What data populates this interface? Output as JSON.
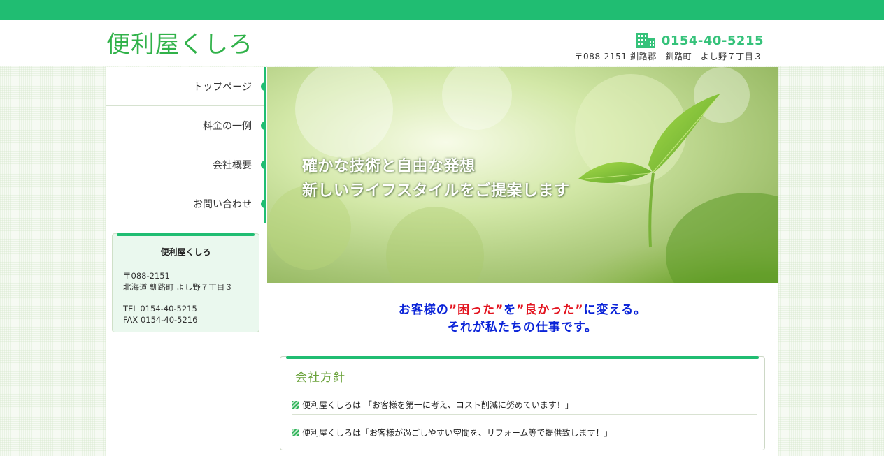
{
  "header": {
    "site_title": "便利屋くしろ",
    "phone": "0154-40-5215",
    "address": "〒088-2151 釧路郡　釧路町　よし野７丁目３",
    "phone_icon": "building-icon"
  },
  "nav": {
    "items": [
      {
        "label": "トップページ"
      },
      {
        "label": "料金の一例"
      },
      {
        "label": "会社概要"
      },
      {
        "label": "お問い合わせ"
      }
    ]
  },
  "info": {
    "title": "便利屋くしろ",
    "postal": "〒088-2151",
    "address": "北海道 釧路町 よし野７丁目３",
    "tel": "TEL 0154-40-5215",
    "fax": "FAX 0154-40-5216"
  },
  "hero": {
    "line1": "確かな技術と自由な発想",
    "line2": "新しいライフスタイルをご提案します"
  },
  "catch": {
    "part1": "お客様の",
    "red1": "”困った”",
    "part2": "を",
    "red2": "”良かった”",
    "part3": "に変える。",
    "line2": "それが私たちの仕事です。"
  },
  "policy": {
    "title": "会社方針",
    "items": [
      {
        "text": "便利屋くしろは 「お客様を第一に考え、コスト削減に努めています！」"
      },
      {
        "text": "便利屋くしろは「お客様が過ごしやすい空間を、リフォーム等で提供致します！」"
      }
    ]
  },
  "colors": {
    "accent": "#20bd72",
    "title_green": "#31b24a",
    "catch_blue": "#0a23d8",
    "catch_red": "#e3141f"
  }
}
